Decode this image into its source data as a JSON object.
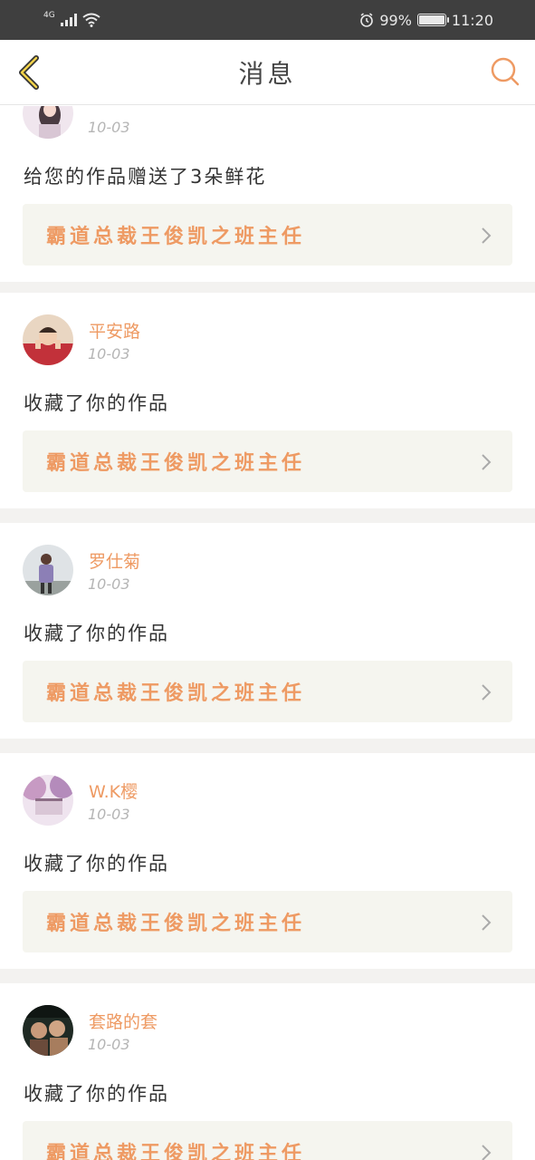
{
  "status_bar": {
    "network": "4G",
    "battery": "99%",
    "time": "11:20"
  },
  "header": {
    "title": "消息"
  },
  "messages": [
    {
      "name": "",
      "date": "10-03",
      "action": "给您的作品赠送了3朵鲜花",
      "work_title": "霸道总裁王俊凯之班主任"
    },
    {
      "name": "平安路",
      "date": "10-03",
      "action": "收藏了你的作品",
      "work_title": "霸道总裁王俊凯之班主任"
    },
    {
      "name": "罗仕菊",
      "date": "10-03",
      "action": "收藏了你的作品",
      "work_title": "霸道总裁王俊凯之班主任"
    },
    {
      "name": "W.K樱",
      "date": "10-03",
      "action": "收藏了你的作品",
      "work_title": "霸道总裁王俊凯之班主任"
    },
    {
      "name": "套路的套",
      "date": "10-03",
      "action": "收藏了你的作品",
      "work_title": "霸道总裁王俊凯之班主任"
    }
  ],
  "icons": {
    "back": "chevron-left-icon",
    "search": "search-icon",
    "item_arrow": "chevron-right-icon"
  },
  "colors": {
    "accent": "#ee9a63",
    "status_bar": "#3f3f3f",
    "link_box_bg": "#f5f5ef",
    "divider": "#f3f2f0"
  }
}
